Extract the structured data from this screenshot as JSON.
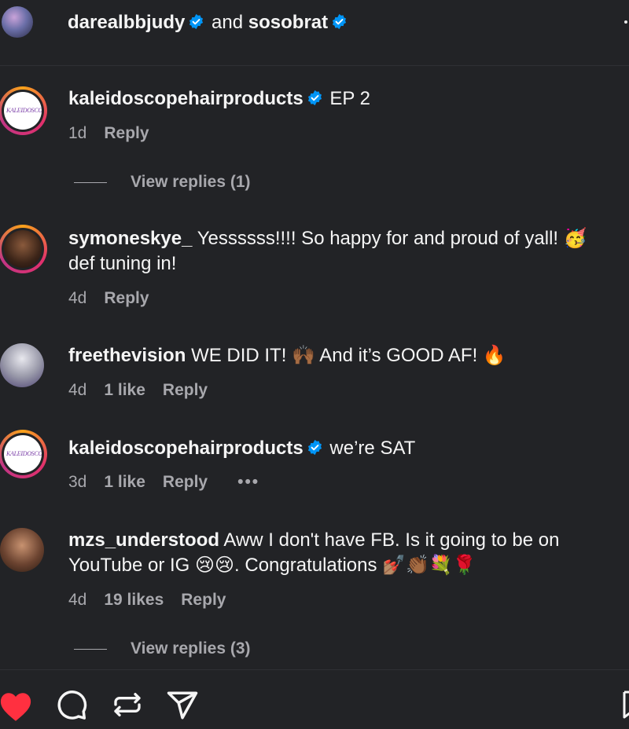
{
  "header": {
    "user1": "darealbbjudy",
    "conjunction": "and",
    "user2": "sosobrat"
  },
  "comments": [
    {
      "user": "kaleidoscopehairproducts",
      "verified": true,
      "text": "EP 2",
      "age": "1d",
      "likes": "",
      "reply": "Reply",
      "view_replies": "View replies (1)",
      "avatar_text": "KALEIDOSCOPE"
    },
    {
      "user": "symoneskye_",
      "verified": false,
      "text": "Yessssss!!!! So happy for and proud of yall! 🥳 def tuning in!",
      "age": "4d",
      "likes": "",
      "reply": "Reply"
    },
    {
      "user": "freethevision",
      "verified": false,
      "text": "WE DID IT! 🙌🏾 And it’s GOOD AF! 🔥",
      "age": "4d",
      "likes": "1 like",
      "reply": "Reply"
    },
    {
      "user": "kaleidoscopehairproducts",
      "verified": true,
      "text": "we’re SAT",
      "age": "3d",
      "likes": "1 like",
      "reply": "Reply",
      "more": "•••",
      "avatar_text": "KALEIDOSCOPE"
    },
    {
      "user": "mzs_understood",
      "verified": false,
      "text": "Aww I don't have FB. Is it going to be on YouTube or IG 😢😢. Congratulations 💅🏽👏🏾💐🌹",
      "age": "4d",
      "likes": "19 likes",
      "reply": "Reply",
      "view_replies": "View replies (3)"
    }
  ],
  "actions": {
    "icons": [
      "heart-icon",
      "comment-icon",
      "repost-icon",
      "share-icon",
      "save-icon"
    ],
    "heart_color": "#ff3040"
  }
}
